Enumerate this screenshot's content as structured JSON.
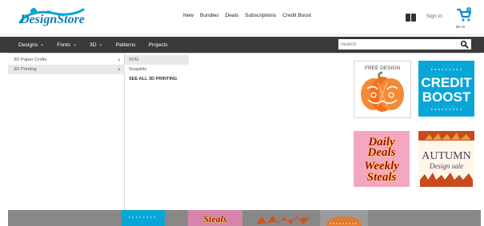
{
  "header": {
    "logo_text": "DesignStore",
    "nav_links": [
      "New",
      "Bundles",
      "Deals",
      "Subscriptions",
      "Credit Boost"
    ],
    "signin_label": "Sign In",
    "cart_total": "$0.00"
  },
  "main_nav": {
    "items": [
      {
        "label": "Designs",
        "has_chevron": true
      },
      {
        "label": "Fonts",
        "has_chevron": true
      },
      {
        "label": "3D",
        "has_chevron": true
      },
      {
        "label": "Patterns",
        "has_chevron": false
      },
      {
        "label": "Projects",
        "has_chevron": false
      }
    ],
    "search_placeholder": "Search"
  },
  "dropdown": {
    "categories": [
      {
        "label": "3D Paper Crafts",
        "active": false
      },
      {
        "label": "3D Printing",
        "active": true
      }
    ],
    "subcategories": [
      {
        "label": "SVG",
        "active": true,
        "strong": false
      },
      {
        "label": "Snapkits",
        "active": false,
        "strong": false
      },
      {
        "label": "SEE ALL 3D PRINTING",
        "active": false,
        "strong": true
      }
    ]
  },
  "promos": {
    "free_design": "FREE DESIGN",
    "credit_top": "CREDIT",
    "credit_bottom": "BOOST",
    "daily_line1": "Daily",
    "daily_line2": "Deals",
    "daily_line3": "Weekly",
    "daily_line4": "Steals",
    "autumn_line1": "AUTUMN",
    "autumn_line2": "Design sale"
  },
  "colors": {
    "nav_bg": "#3a3a3a",
    "credit_blue": "#08a6d7",
    "pink": "#f4a7c1",
    "pumpkin_orange": "#f26f1f",
    "leaf_orange": "#d4541d"
  }
}
